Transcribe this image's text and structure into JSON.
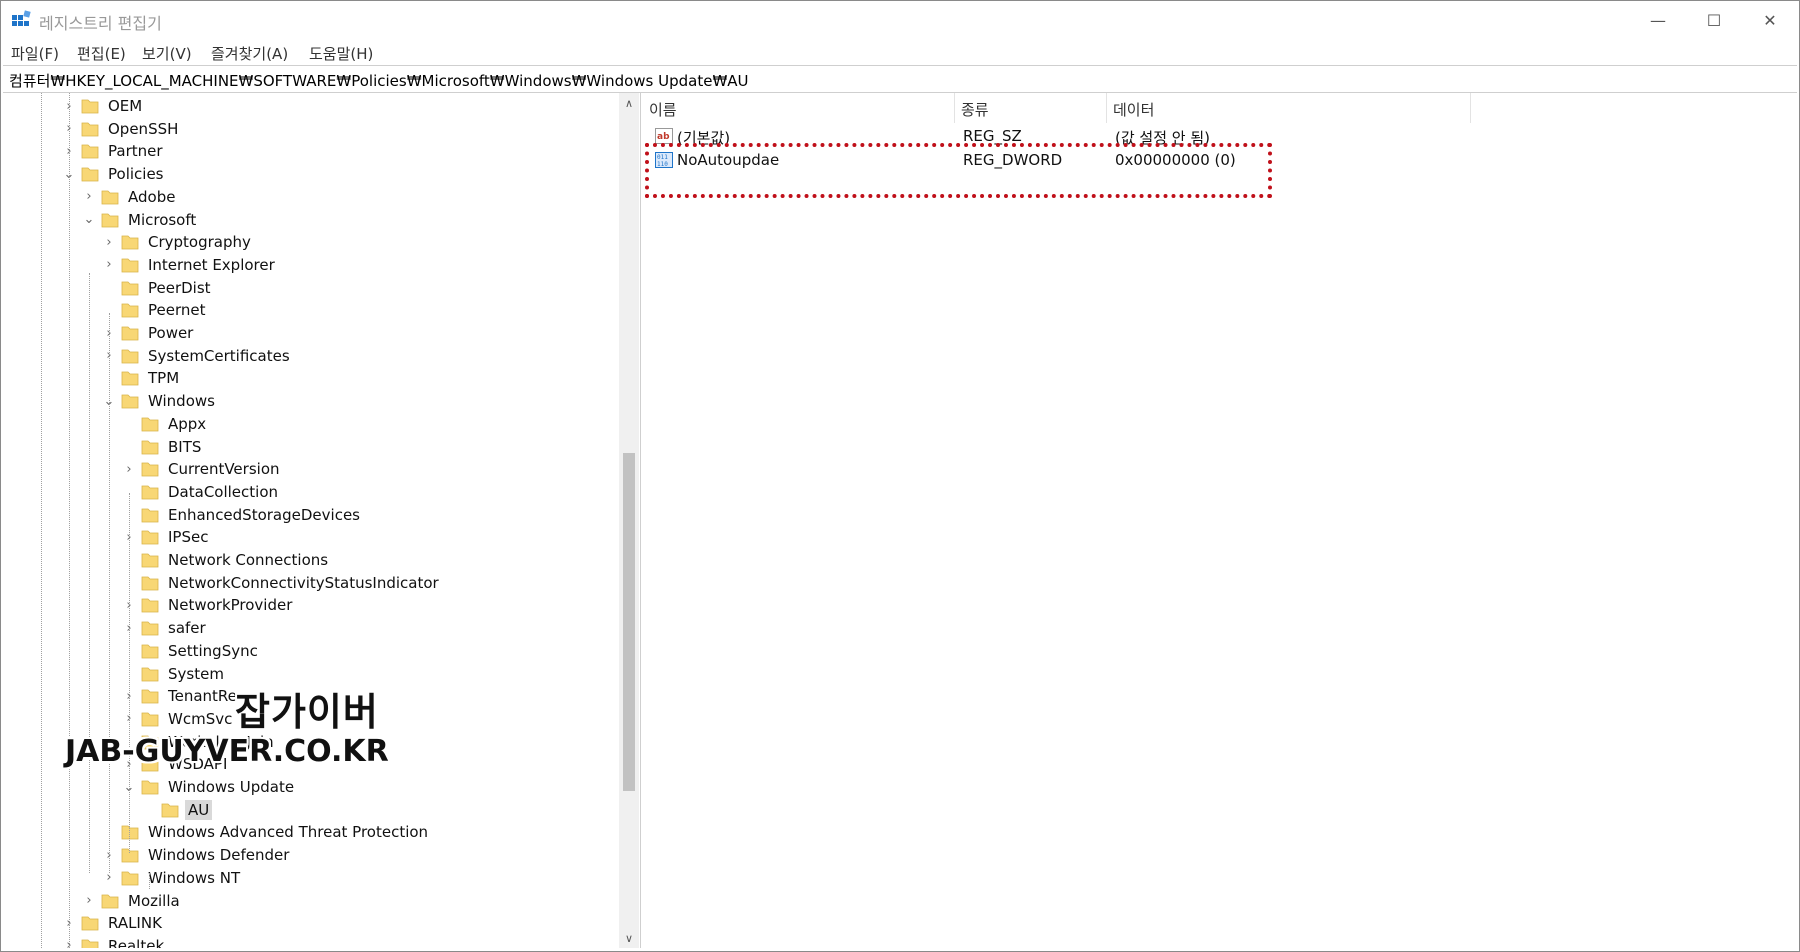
{
  "window": {
    "title": "레지스트리 편집기",
    "controls": {
      "minimize": "—",
      "maximize": "☐",
      "close": "✕"
    }
  },
  "menu": {
    "items": [
      "파일(F)",
      "편집(E)",
      "보기(V)",
      "즐겨찾기(A)",
      "도움말(H)"
    ]
  },
  "address": {
    "path": "컴퓨터₩HKEY_LOCAL_MACHINE₩SOFTWARE₩Policies₩Microsoft₩Windows₩Windows Update₩AU"
  },
  "tree": {
    "nodes": [
      {
        "label": "OEM",
        "expander": "›"
      },
      {
        "label": "OpenSSH",
        "expander": "›"
      },
      {
        "label": "Partner",
        "expander": "›"
      },
      {
        "label": "Policies",
        "expander": "⌄"
      },
      {
        "label": "Adobe",
        "expander": "›"
      },
      {
        "label": "Microsoft",
        "expander": "⌄"
      },
      {
        "label": "Cryptography",
        "expander": "›"
      },
      {
        "label": "Internet Explorer",
        "expander": "›"
      },
      {
        "label": "PeerDist",
        "expander": ""
      },
      {
        "label": "Peernet",
        "expander": ""
      },
      {
        "label": "Power",
        "expander": "›"
      },
      {
        "label": "SystemCertificates",
        "expander": "›"
      },
      {
        "label": "TPM",
        "expander": ""
      },
      {
        "label": "Windows",
        "expander": "⌄"
      },
      {
        "label": "Appx",
        "expander": ""
      },
      {
        "label": "BITS",
        "expander": ""
      },
      {
        "label": "CurrentVersion",
        "expander": "›"
      },
      {
        "label": "DataCollection",
        "expander": ""
      },
      {
        "label": "EnhancedStorageDevices",
        "expander": ""
      },
      {
        "label": "IPSec",
        "expander": "›"
      },
      {
        "label": "Network Connections",
        "expander": ""
      },
      {
        "label": "NetworkConnectivityStatusIndicator",
        "expander": ""
      },
      {
        "label": "NetworkProvider",
        "expander": "›"
      },
      {
        "label": "safer",
        "expander": "›"
      },
      {
        "label": "SettingSync",
        "expander": ""
      },
      {
        "label": "System",
        "expander": ""
      },
      {
        "label": "TenantRe",
        "expander": "›"
      },
      {
        "label": "WcmSvc",
        "expander": "›"
      },
      {
        "label": "WorkplaceJoin",
        "expander": ""
      },
      {
        "label": "WSDAPI",
        "expander": "›"
      },
      {
        "label": "Windows Update",
        "expander": "⌄"
      },
      {
        "label": "AU",
        "expander": ""
      },
      {
        "label": "Windows Advanced Threat Protection",
        "expander": ""
      },
      {
        "label": "Windows Defender",
        "expander": "›"
      },
      {
        "label": "Windows NT",
        "expander": "›"
      },
      {
        "label": "Mozilla",
        "expander": "›"
      },
      {
        "label": "RALINK",
        "expander": "›"
      },
      {
        "label": "Realtek",
        "expander": "›"
      }
    ],
    "scroll_up": "∧",
    "scroll_down": "∨"
  },
  "list": {
    "columns": [
      "이름",
      "종류",
      "데이터"
    ],
    "rows": [
      {
        "icon": "string-value-icon",
        "name": "(기본값)",
        "type": "REG_SZ",
        "data": "(값 설정 안 됨)"
      },
      {
        "icon": "dword-value-icon",
        "name": "NoAutoupdae",
        "type": "REG_DWORD",
        "data": "0x00000000 (0)"
      }
    ]
  },
  "watermark": {
    "korean": "잡가이버",
    "site": "JAB-GUYVER.CO.KR"
  },
  "colors": {
    "folder": "#f8d775",
    "highlight_border": "#c0101a",
    "selection": "#d9d9d9",
    "icon_blue": "#1e74c9"
  }
}
